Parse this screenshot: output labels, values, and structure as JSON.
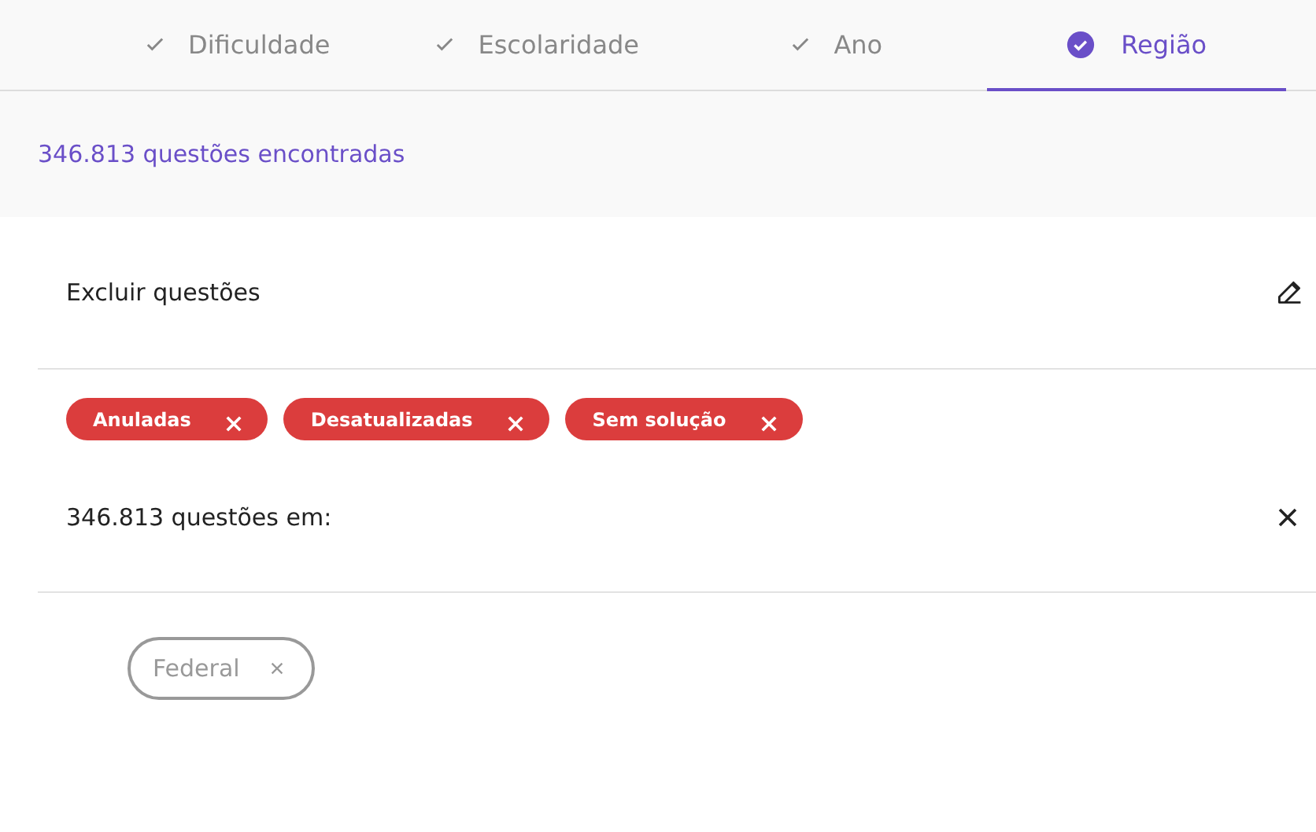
{
  "tabs": [
    {
      "label": "Dificuldade",
      "selected": false
    },
    {
      "label": "Escolaridade",
      "selected": false
    },
    {
      "label": "Ano",
      "selected": false
    },
    {
      "label": "Região",
      "selected": true
    }
  ],
  "result_count": "346.813 questões encontradas",
  "exclude": {
    "title": "Excluir questões",
    "tags": [
      {
        "label": "Anuladas"
      },
      {
        "label": "Desatualizadas"
      },
      {
        "label": "Sem solução"
      }
    ]
  },
  "filters": {
    "title": "346.813 questões em:",
    "chips": [
      {
        "label": "Federal"
      }
    ]
  }
}
